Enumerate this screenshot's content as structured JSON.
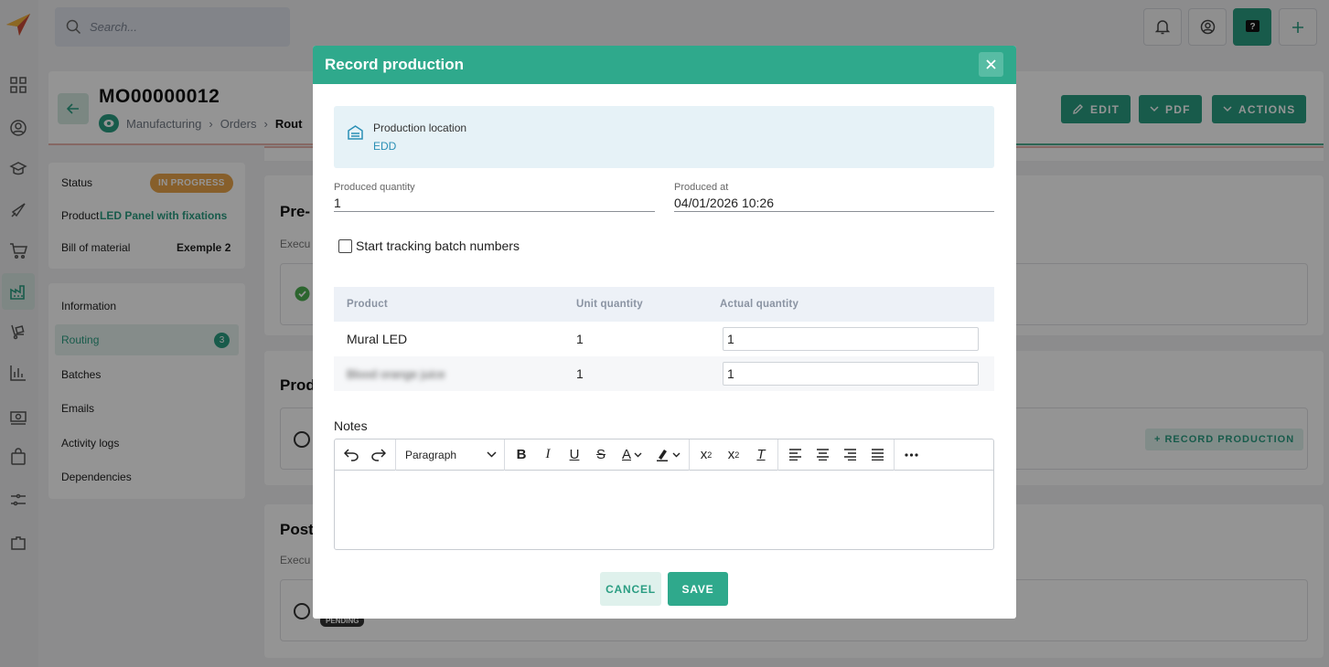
{
  "search": {
    "placeholder": "Search..."
  },
  "colors": {
    "accent": "#2fa98c",
    "status_in_progress": "#e8a44b",
    "overlay": "rgba(0,0,0,0.42)"
  },
  "rail_icons": [
    "logo-icon",
    "dashboard-icon",
    "contacts-icon",
    "products-icon",
    "sales-icon",
    "cart-icon",
    "manufacturing-icon",
    "shipping-icon",
    "reports-icon",
    "finance-icon",
    "bag-icon",
    "settings-icon",
    "plugins-icon"
  ],
  "topbar_icons": [
    "bell-icon",
    "user-icon",
    "help-icon",
    "plus-icon"
  ],
  "order": {
    "number": "MO00000012",
    "breadcrumbs": [
      "Manufacturing",
      "Orders",
      "Rout"
    ],
    "actions": {
      "edit": "EDIT",
      "pdf": "PDF",
      "actions": "ACTIONS"
    }
  },
  "summary": {
    "status_label": "Status",
    "status_value": "IN PROGRESS",
    "product_label": "Product",
    "product_value": "LED Panel with fixations",
    "bom_label": "Bill of material",
    "bom_value": "Exemple 2"
  },
  "menu": {
    "items": [
      {
        "label": "Information"
      },
      {
        "label": "Routing",
        "count": "3"
      },
      {
        "label": "Batches"
      },
      {
        "label": "Emails"
      },
      {
        "label": "Activity logs"
      },
      {
        "label": "Dependencies"
      }
    ]
  },
  "background_sections": {
    "pre_title": "Pre-",
    "pre_exec": "Execu",
    "prod_title": "Prod",
    "record_production": "RECORD PRODUCTION",
    "post_title": "Post",
    "post_exec": "Execu",
    "pending_badge": "PENDING"
  },
  "modal": {
    "title": "Record production",
    "location_label": "Production location",
    "location_value": "EDD",
    "produced_quantity_label": "Produced quantity",
    "produced_quantity_value": "1",
    "produced_at_label": "Produced at",
    "produced_at_value": "04/01/2026 10:26",
    "batch_checkbox_label": "Start tracking batch numbers",
    "batch_checked": false,
    "table": {
      "columns": [
        "Product",
        "Unit quantity",
        "Actual quantity"
      ],
      "rows": [
        {
          "product": "Mural LED",
          "unit_quantity": "1",
          "actual_quantity": "1"
        },
        {
          "product": "Blood orange juice",
          "unit_quantity": "1",
          "actual_quantity": "1"
        }
      ]
    },
    "notes_label": "Notes",
    "editor": {
      "block_format": "Paragraph"
    },
    "cancel": "CANCEL",
    "save": "SAVE"
  }
}
